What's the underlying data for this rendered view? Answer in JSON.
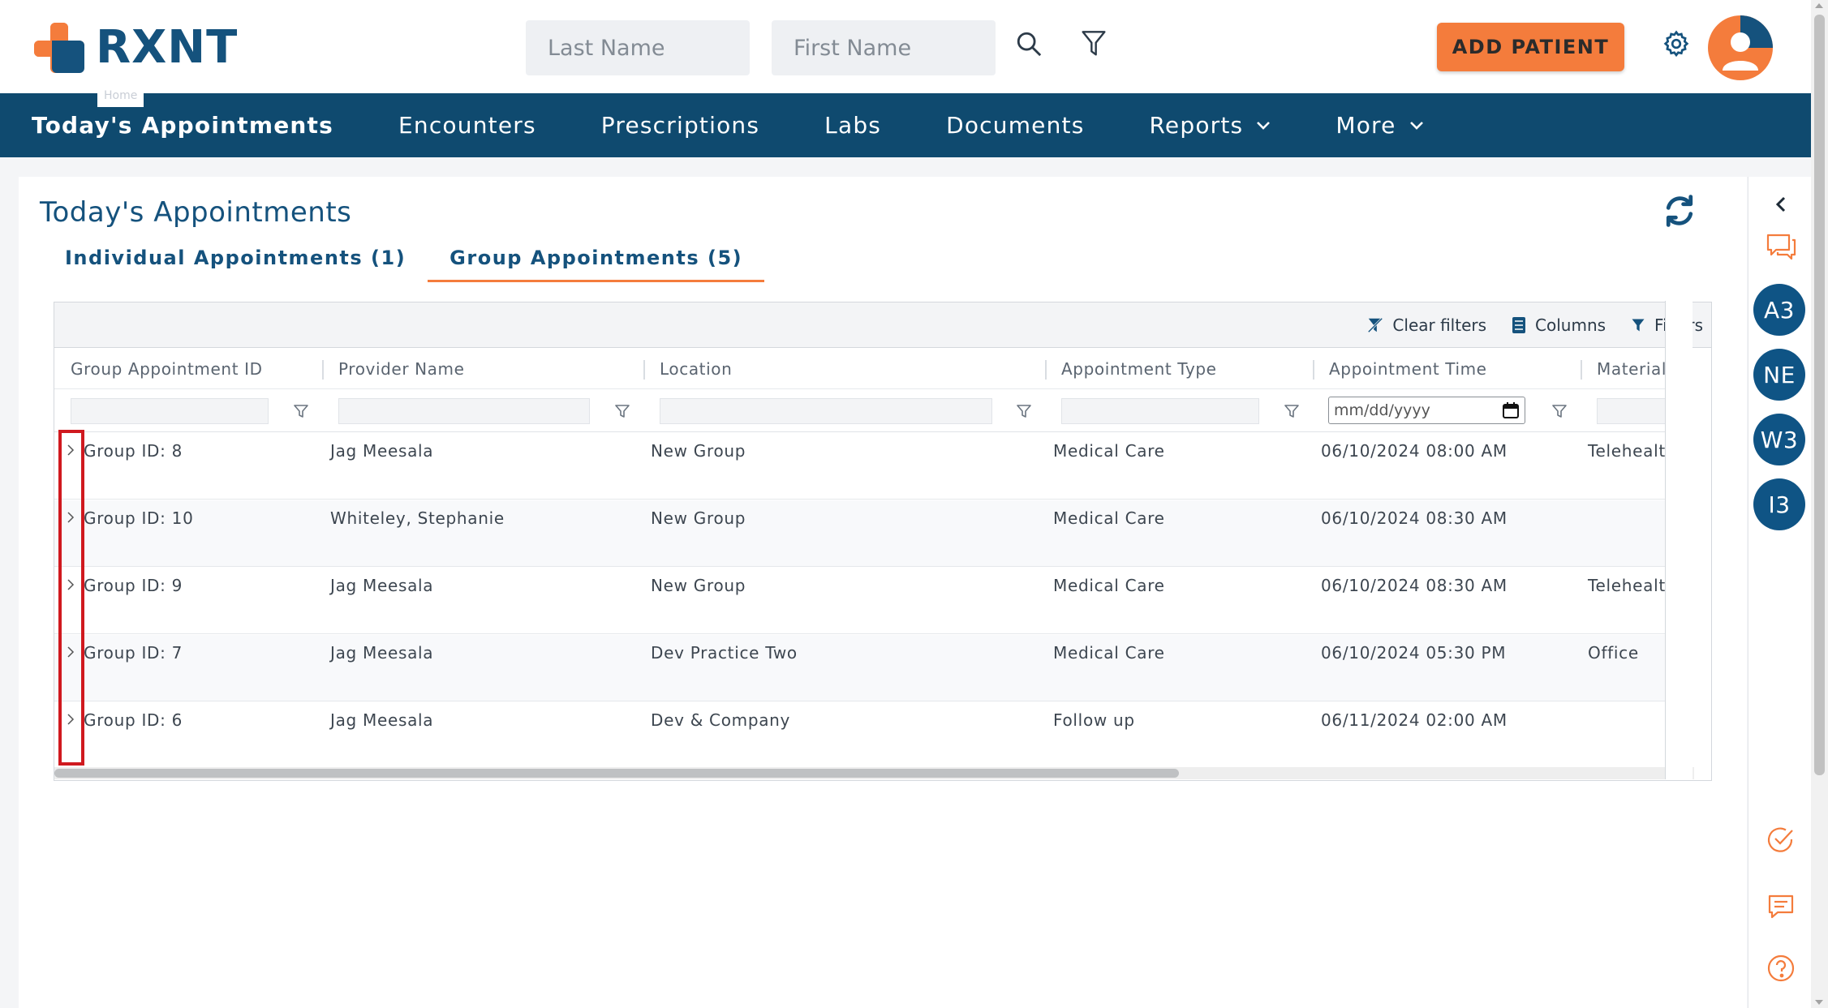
{
  "brand": {
    "name": "RXNT",
    "orange": "#f47c3c",
    "navy": "#15527d",
    "nav_bg": "#0f4a6f"
  },
  "header": {
    "last_name_placeholder": "Last Name",
    "first_name_placeholder": "First Name",
    "add_patient_label": "ADD PATIENT",
    "home_tooltip": "Home",
    "icons": [
      "search-icon",
      "filter-icon",
      "gear-icon",
      "user-avatar"
    ]
  },
  "nav": {
    "items": [
      {
        "label": "Today's Appointments",
        "active": true
      },
      {
        "label": "Encounters"
      },
      {
        "label": "Prescriptions"
      },
      {
        "label": "Labs"
      },
      {
        "label": "Documents"
      },
      {
        "label": "Reports",
        "has_dropdown": true
      },
      {
        "label": "More",
        "has_dropdown": true
      }
    ]
  },
  "page": {
    "title": "Today's Appointments",
    "tabs": [
      {
        "label": "Individual Appointments (1)",
        "active": false
      },
      {
        "label": "Group Appointments (5)",
        "active": true
      }
    ]
  },
  "grid": {
    "toolbar": {
      "clear_filters": "Clear filters",
      "columns": "Columns",
      "filters": "Filters"
    },
    "columns": [
      "Group Appointment ID",
      "Provider Name",
      "Location",
      "Appointment Type",
      "Appointment Time",
      "Material"
    ],
    "date_placeholder": "mm/dd/yyyy",
    "rows": [
      {
        "id": "Group ID: 8",
        "provider": "Jag Meesala",
        "location": "New Group",
        "type": "Medical Care",
        "time": "06/10/2024 08:00 AM",
        "material": "Telehealt"
      },
      {
        "id": "Group ID: 10",
        "provider": "Whiteley, Stephanie",
        "location": "New Group",
        "type": "Medical Care",
        "time": "06/10/2024 08:30 AM",
        "material": ""
      },
      {
        "id": "Group ID: 9",
        "provider": "Jag Meesala",
        "location": "New Group",
        "type": "Medical Care",
        "time": "06/10/2024 08:30 AM",
        "material": "Telehealt"
      },
      {
        "id": "Group ID: 7",
        "provider": "Jag Meesala",
        "location": "Dev Practice Two",
        "type": "Medical Care",
        "time": "06/10/2024 05:30 PM",
        "material": "Office"
      },
      {
        "id": "Group ID: 6",
        "provider": "Jag Meesala",
        "location": "Dev & Company",
        "type": "Follow up",
        "time": "06/11/2024 02:00 AM",
        "material": ""
      }
    ]
  },
  "rail": {
    "avatars": [
      "A3",
      "NE",
      "W3",
      "I3"
    ],
    "icons": [
      "chevron-left-icon",
      "chat-bubbles-icon",
      "check-circle-icon",
      "message-icon",
      "help-icon"
    ]
  }
}
